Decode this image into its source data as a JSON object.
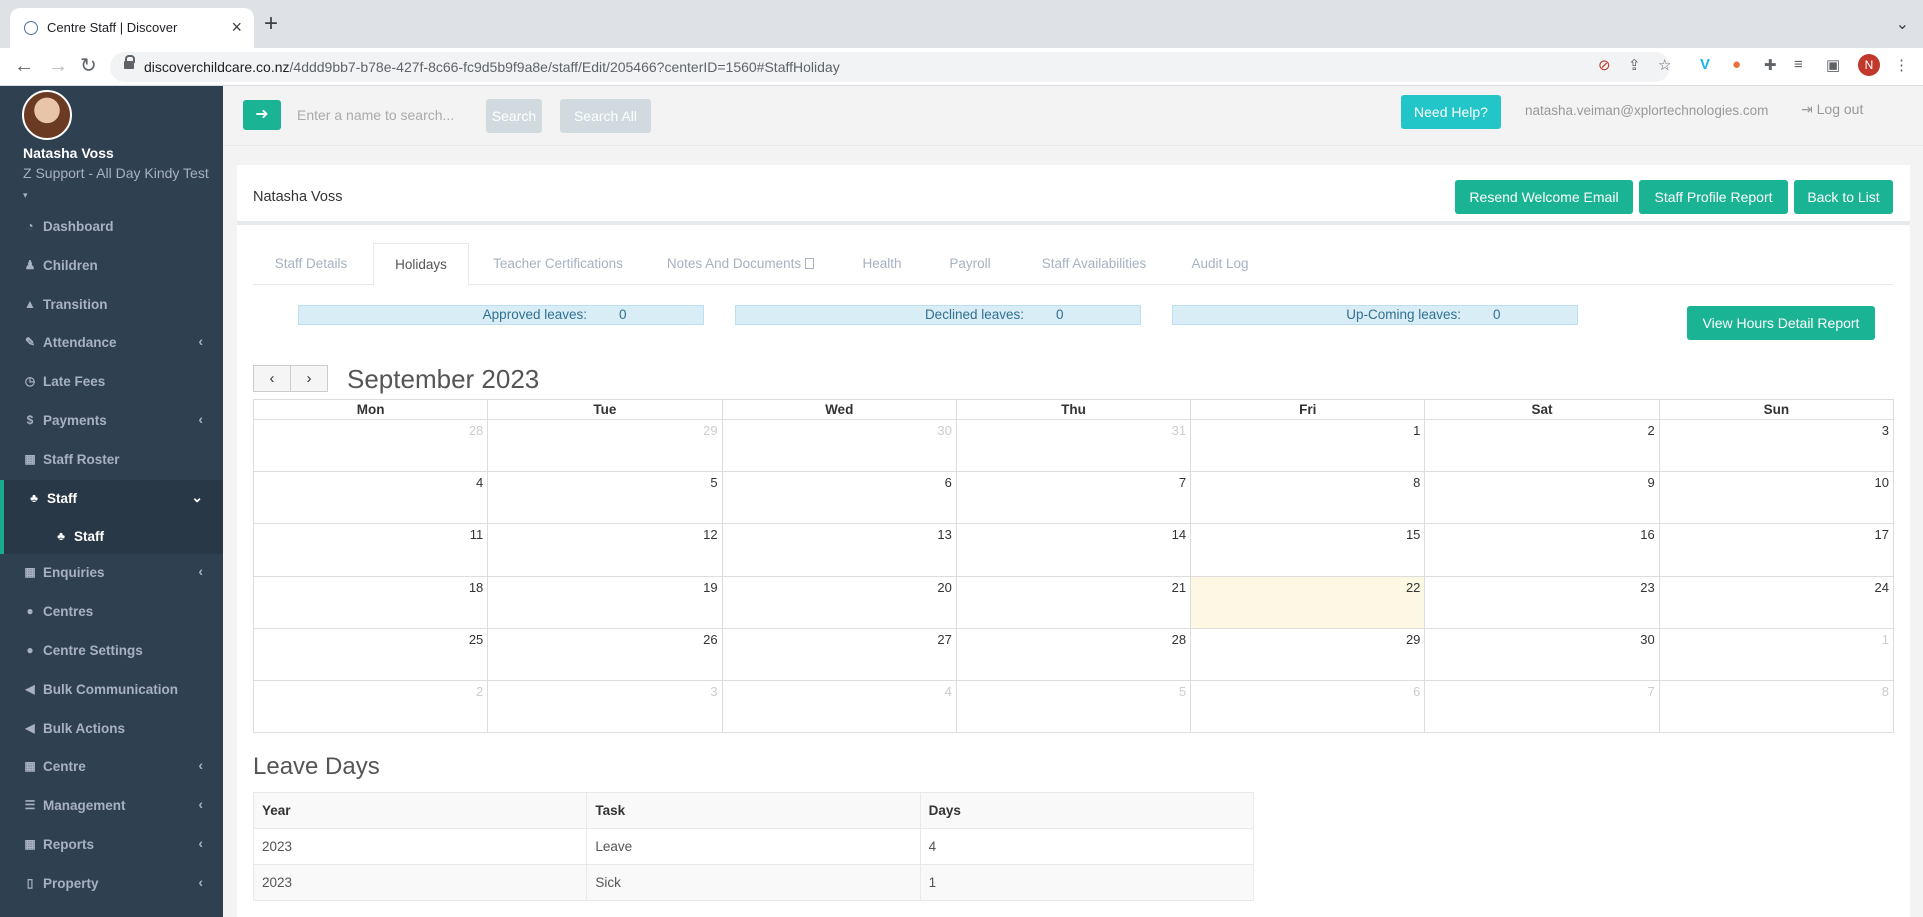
{
  "browser": {
    "tab_title": "Centre Staff | Discover",
    "url_host": "discoverchildcare.co.nz",
    "url_path": "/4ddd9bb7-b78e-427f-8c66-fc9d5b9f9a8e/staff/Edit/205466?centerID=1560#StaffHoliday",
    "profile_initial": "N"
  },
  "sidebar": {
    "user_name": "Natasha Voss",
    "centre": "Z Support - All Day Kindy Test",
    "items": [
      {
        "label": "Dashboard",
        "icon": "dashboard-icon",
        "glyph": "◔",
        "arrow": ""
      },
      {
        "label": "Children",
        "icon": "child-icon",
        "glyph": "♟",
        "arrow": ""
      },
      {
        "label": "Transition",
        "icon": "graduation-cap-icon",
        "glyph": "▲",
        "arrow": ""
      },
      {
        "label": "Attendance",
        "icon": "edit-icon",
        "glyph": "✎",
        "arrow": "‹"
      },
      {
        "label": "Late Fees",
        "icon": "clock-icon",
        "glyph": "◷",
        "arrow": ""
      },
      {
        "label": "Payments",
        "icon": "dollar-icon",
        "glyph": "$",
        "arrow": "‹"
      },
      {
        "label": "Staff Roster",
        "icon": "calendar-icon",
        "glyph": "▦",
        "arrow": ""
      },
      {
        "label": "Staff",
        "icon": "sitemap-icon",
        "glyph": "♣",
        "arrow": "⌄"
      },
      {
        "label": "Staff",
        "icon": "sitemap-icon",
        "glyph": "♣",
        "arrow": ""
      },
      {
        "label": "Enquiries",
        "icon": "grid-icon",
        "glyph": "▦",
        "arrow": "‹"
      },
      {
        "label": "Centres",
        "icon": "circle-icon",
        "glyph": "●",
        "arrow": ""
      },
      {
        "label": "Centre Settings",
        "icon": "circle-icon",
        "glyph": "●",
        "arrow": ""
      },
      {
        "label": "Bulk Communication",
        "icon": "bullhorn-icon",
        "glyph": "◀",
        "arrow": ""
      },
      {
        "label": "Bulk Actions",
        "icon": "bullhorn-icon",
        "glyph": "◀",
        "arrow": ""
      },
      {
        "label": "Centre",
        "icon": "grid-icon",
        "glyph": "▦",
        "arrow": "‹"
      },
      {
        "label": "Management",
        "icon": "list-icon",
        "glyph": "☰",
        "arrow": "‹"
      },
      {
        "label": "Reports",
        "icon": "grid-icon",
        "glyph": "▦",
        "arrow": "‹"
      },
      {
        "label": "Property",
        "icon": "building-icon",
        "glyph": "▯",
        "arrow": "‹"
      }
    ]
  },
  "topbar": {
    "search_placeholder": "Enter a name to search...",
    "search_label": "Search",
    "search_all_label": "Search All",
    "help_label": "Need Help?",
    "email": "natasha.veiman@xplortechnologies.com",
    "logout_label": "Log out"
  },
  "header": {
    "staff_name": "Natasha Voss",
    "resend_label": "Resend Welcome Email",
    "profile_report_label": "Staff Profile Report",
    "back_label": "Back to List"
  },
  "tabs": [
    "Staff Details",
    "Holidays",
    "Teacher Certifications",
    "Notes And Documents",
    "Health",
    "Payroll",
    "Staff Availabilities",
    "Audit Log"
  ],
  "stats": {
    "approved_label": "Approved leaves:",
    "approved_value": "0",
    "declined_label": "Declined leaves:",
    "declined_value": "0",
    "upcoming_label": "Up-Coming leaves:",
    "upcoming_value": "0",
    "hours_report_label": "View Hours Detail Report"
  },
  "calendar": {
    "title": "September 2023",
    "prev": "‹",
    "next": "›",
    "weekdays": [
      "Mon",
      "Tue",
      "Wed",
      "Thu",
      "Fri",
      "Sat",
      "Sun"
    ],
    "weeks": [
      [
        {
          "d": "28",
          "o": true
        },
        {
          "d": "29",
          "o": true
        },
        {
          "d": "30",
          "o": true
        },
        {
          "d": "31",
          "o": true
        },
        {
          "d": "1"
        },
        {
          "d": "2"
        },
        {
          "d": "3"
        }
      ],
      [
        {
          "d": "4"
        },
        {
          "d": "5"
        },
        {
          "d": "6"
        },
        {
          "d": "7"
        },
        {
          "d": "8"
        },
        {
          "d": "9"
        },
        {
          "d": "10"
        }
      ],
      [
        {
          "d": "11"
        },
        {
          "d": "12"
        },
        {
          "d": "13"
        },
        {
          "d": "14"
        },
        {
          "d": "15"
        },
        {
          "d": "16"
        },
        {
          "d": "17"
        }
      ],
      [
        {
          "d": "18"
        },
        {
          "d": "19"
        },
        {
          "d": "20"
        },
        {
          "d": "21"
        },
        {
          "d": "22",
          "t": true
        },
        {
          "d": "23"
        },
        {
          "d": "24"
        }
      ],
      [
        {
          "d": "25"
        },
        {
          "d": "26"
        },
        {
          "d": "27"
        },
        {
          "d": "28"
        },
        {
          "d": "29"
        },
        {
          "d": "30"
        },
        {
          "d": "1",
          "o": true
        }
      ],
      [
        {
          "d": "2",
          "o": true
        },
        {
          "d": "3",
          "o": true
        },
        {
          "d": "4",
          "o": true
        },
        {
          "d": "5",
          "o": true
        },
        {
          "d": "6",
          "o": true
        },
        {
          "d": "7",
          "o": true
        },
        {
          "d": "8",
          "o": true
        }
      ]
    ]
  },
  "leave_days": {
    "title": "Leave Days",
    "columns": [
      "Year",
      "Task",
      "Days"
    ],
    "rows": [
      [
        "2023",
        "Leave",
        "4"
      ],
      [
        "2023",
        "Sick",
        "1"
      ]
    ]
  },
  "colors": {
    "sidebar_bg": "#2f4050",
    "accent_green": "#1ab394",
    "help_cyan": "#23c6c8",
    "today_bg": "#fcf8e3",
    "stat_bg": "#d9edf7"
  }
}
